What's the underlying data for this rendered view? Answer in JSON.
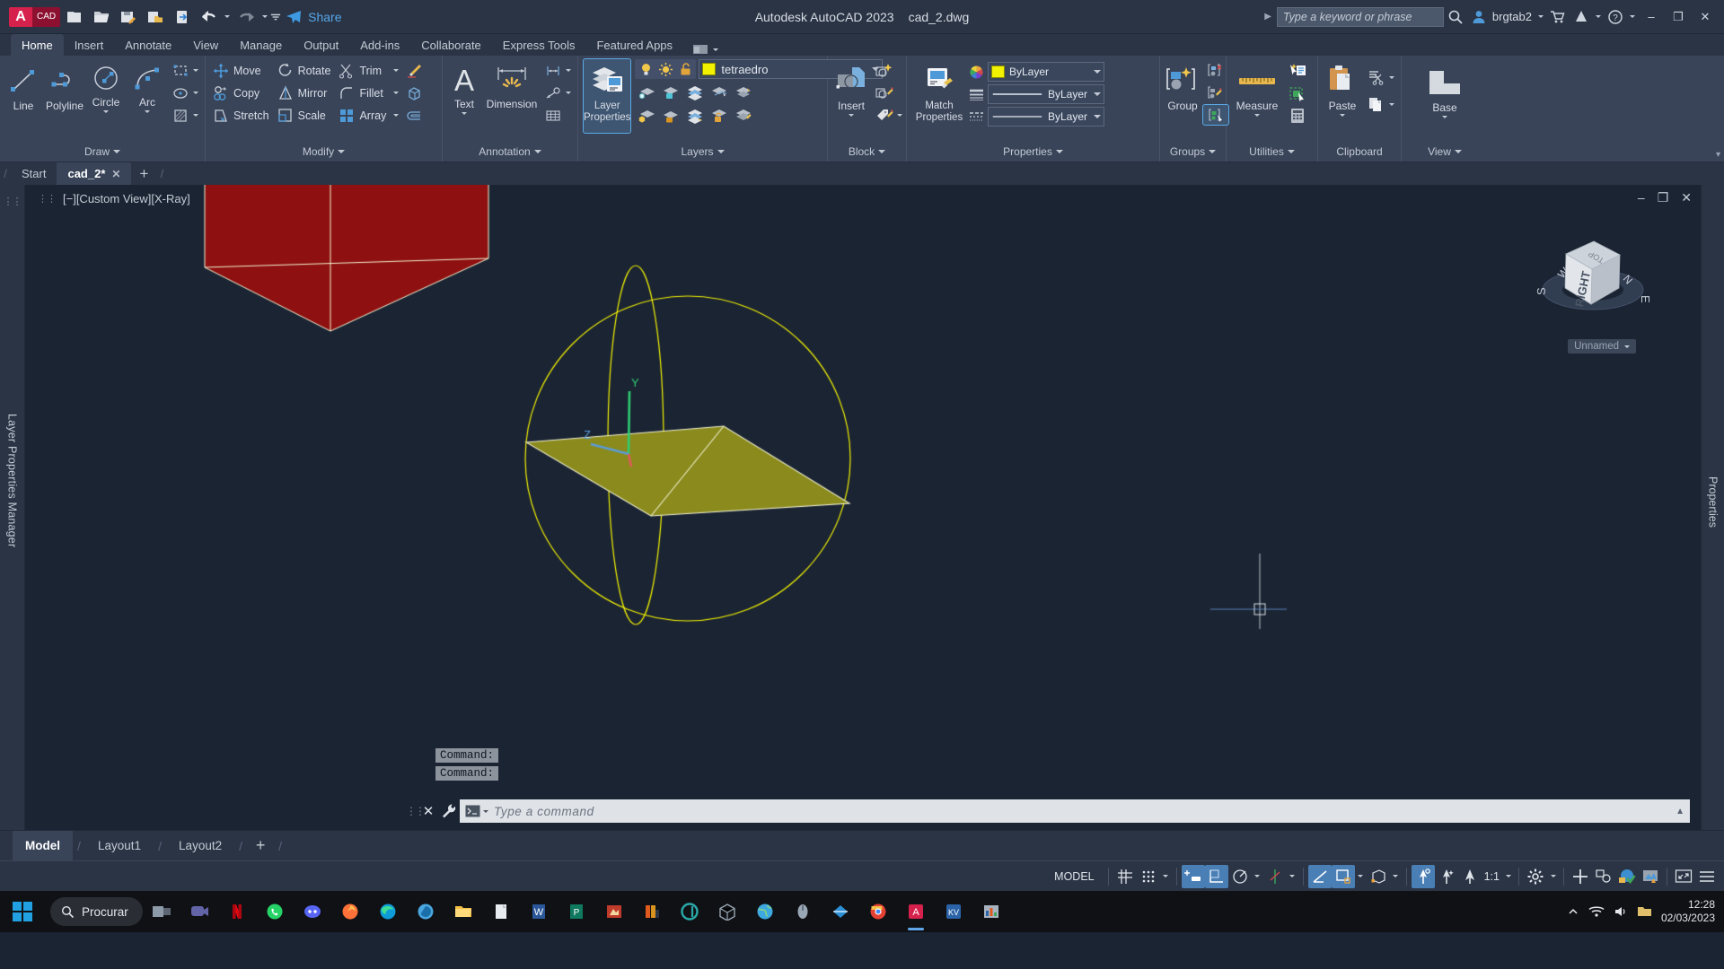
{
  "titlebar": {
    "logo_a": "A",
    "logo_cad": "CAD",
    "share_label": "Share",
    "app_title": "Autodesk AutoCAD 2023",
    "file_name": "cad_2.dwg",
    "search_placeholder": "Type a keyword or phrase",
    "user_name": "brgtab2",
    "quick_access": [
      {
        "name": "new-icon",
        "label": "New"
      },
      {
        "name": "open-icon",
        "label": "Open"
      },
      {
        "name": "save-icon",
        "label": "Save"
      },
      {
        "name": "saveas-icon",
        "label": "Save As"
      },
      {
        "name": "plot-icon",
        "label": "Plot"
      },
      {
        "name": "undo-icon",
        "label": "Undo"
      },
      {
        "name": "redo-icon",
        "label": "Redo"
      }
    ],
    "window_buttons": {
      "minimize": "–",
      "maximize": "❐",
      "close": "✕"
    }
  },
  "ribbon_tabs": [
    {
      "label": "Home",
      "active": true
    },
    {
      "label": "Insert",
      "active": false
    },
    {
      "label": "Annotate",
      "active": false
    },
    {
      "label": "View",
      "active": false
    },
    {
      "label": "Manage",
      "active": false
    },
    {
      "label": "Output",
      "active": false
    },
    {
      "label": "Add-ins",
      "active": false
    },
    {
      "label": "Collaborate",
      "active": false
    },
    {
      "label": "Express Tools",
      "active": false
    },
    {
      "label": "Featured Apps",
      "active": false
    }
  ],
  "ribbon": {
    "draw": {
      "title": "Draw",
      "big": [
        {
          "label": "Line",
          "icon": "line-icon",
          "caret": false
        },
        {
          "label": "Polyline",
          "icon": "polyline-icon",
          "caret": false
        },
        {
          "label": "Circle",
          "icon": "circle-icon",
          "caret": true
        },
        {
          "label": "Arc",
          "icon": "arc-icon",
          "caret": true
        }
      ],
      "small": [
        {
          "label": "",
          "icon": "rectangle-icon",
          "caret": true
        },
        {
          "label": "",
          "icon": "ellipse-icon",
          "caret": true
        },
        {
          "label": "",
          "icon": "hatch-icon",
          "caret": true
        }
      ]
    },
    "modify": {
      "title": "Modify",
      "items": [
        {
          "label": "Move",
          "icon": "move-icon"
        },
        {
          "label": "Rotate",
          "icon": "rotate-icon"
        },
        {
          "label": "Trim",
          "icon": "trim-icon",
          "caret": true
        },
        {
          "label": "Copy",
          "icon": "copy-icon"
        },
        {
          "label": "Mirror",
          "icon": "mirror-icon"
        },
        {
          "label": "Fillet",
          "icon": "fillet-icon",
          "caret": true
        },
        {
          "label": "Stretch",
          "icon": "stretch-icon"
        },
        {
          "label": "Scale",
          "icon": "scale-icon"
        },
        {
          "label": "Array",
          "icon": "array-icon",
          "caret": true
        }
      ],
      "extra": [
        {
          "icon": "erase-icon"
        },
        {
          "icon": "explode-icon"
        },
        {
          "icon": "join-icon"
        }
      ]
    },
    "annotation": {
      "title": "Annotation",
      "big": [
        {
          "label": "Text",
          "icon": "text-icon",
          "caret": true
        },
        {
          "label": "Dimension",
          "icon": "dimension-icon",
          "caret": false
        }
      ],
      "small": [
        {
          "icon": "linear-dim-icon",
          "caret": true
        },
        {
          "icon": "leader-icon",
          "caret": true
        },
        {
          "icon": "table-icon",
          "caret": false
        }
      ]
    },
    "layers": {
      "title": "Layers",
      "big": {
        "label": "Layer\nProperties",
        "icon": "layer-properties-icon",
        "selected": true
      },
      "layer_name": "tetraedro",
      "layer_color": "#f2f200",
      "toggles": [
        {
          "icon": "lightbulb-on-icon"
        },
        {
          "icon": "sun-icon"
        },
        {
          "icon": "unlock-icon"
        }
      ],
      "grid_icons": [
        {
          "icon": "layer-isolate-icon"
        },
        {
          "icon": "layer-freeze-icon"
        },
        {
          "icon": "layer-off-icon"
        },
        {
          "icon": "layer-lock-icon"
        },
        {
          "icon": "layer-merge-icon"
        },
        {
          "icon": "layer-unisolate-icon"
        },
        {
          "icon": "layer-thaw-icon"
        },
        {
          "icon": "layer-on-icon"
        },
        {
          "icon": "layer-unlock-icon"
        },
        {
          "icon": "layer-change-icon"
        }
      ]
    },
    "block": {
      "title": "Block",
      "big": {
        "label": "Insert",
        "icon": "insert-block-icon",
        "caret": true
      },
      "small": [
        {
          "icon": "create-block-icon"
        },
        {
          "icon": "edit-block-icon"
        },
        {
          "icon": "define-attributes-icon",
          "caret": true
        }
      ]
    },
    "properties": {
      "title": "Properties",
      "big": {
        "label": "Match\nProperties",
        "icon": "match-properties-icon"
      },
      "color_value": "ByLayer",
      "color_swatch": "#f2f200",
      "linewidth_value": "ByLayer",
      "linetype_value": "ByLayer",
      "icons": [
        {
          "icon": "color-wheel-icon"
        },
        {
          "icon": "lineweight-icon"
        },
        {
          "icon": "linetype-icon"
        }
      ]
    },
    "groups": {
      "title": "Groups",
      "big": {
        "label": "Group",
        "icon": "group-icon"
      },
      "small": [
        {
          "icon": "ungroup-icon"
        },
        {
          "icon": "group-edit-icon"
        },
        {
          "icon": "group-selection-on-icon",
          "selected": true
        }
      ]
    },
    "utilities": {
      "title": "Utilities",
      "big": {
        "label": "Measure",
        "icon": "measure-icon",
        "caret": true
      },
      "small": [
        {
          "icon": "quick-select-icon"
        },
        {
          "icon": "quick-calc-select-icon"
        },
        {
          "icon": "calculator-icon"
        }
      ]
    },
    "clipboard": {
      "title": "Clipboard",
      "big": {
        "label": "Paste",
        "icon": "paste-icon",
        "caret": true
      },
      "small": [
        {
          "icon": "cut-icon",
          "caret": true
        },
        {
          "icon": "copy-clip-icon",
          "caret": true
        }
      ]
    },
    "view": {
      "title": "View",
      "big": {
        "label": "Base",
        "icon": "base-view-icon",
        "caret": true
      }
    }
  },
  "doc_tabs": [
    {
      "label": "Start",
      "active": false,
      "closable": false
    },
    {
      "label": "cad_2*",
      "active": true,
      "closable": true
    }
  ],
  "viewport": {
    "label": "[−][Custom View][X-Ray]",
    "controls": [
      "–",
      "❐",
      "✕"
    ],
    "viewcube_face": "RIGHT",
    "viewcube_top": "TOP",
    "compass": {
      "n": "N",
      "e": "E",
      "s": "S",
      "w": "W"
    },
    "named_view": "Unnamed",
    "ucs_axes": [
      {
        "label": "Y",
        "color": "#2ecc71"
      },
      {
        "label": "Z",
        "color": "#5b9bd5"
      },
      {
        "label": "X",
        "color": "#e05a5a"
      }
    ],
    "shapes": {
      "solid_red_color": "#8e1010",
      "solid_yellow_color": "#8a8a1d",
      "orbit_circle_color": "#f2f200",
      "edge_color": "#f2f2d0"
    }
  },
  "command_history": [
    "Command:",
    "Command:"
  ],
  "command_line": {
    "placeholder": "Type a command",
    "close_label": "✕",
    "tools_icon": "wrench-icon"
  },
  "layout_tabs": [
    {
      "label": "Model",
      "active": true
    },
    {
      "label": "Layout1",
      "active": false
    },
    {
      "label": "Layout2",
      "active": false
    }
  ],
  "statusbar": {
    "model_label": "MODEL",
    "scale": "1:1",
    "items": [
      {
        "name": "grid-display-toggle",
        "icon": "grid-icon",
        "on": false
      },
      {
        "name": "snap-mode-toggle",
        "icon": "snap-icon",
        "on": false,
        "caret": true
      },
      {
        "name": "infer-constraints-toggle",
        "icon": "infer-icon",
        "on": true
      },
      {
        "name": "ortho-mode-toggle",
        "icon": "ortho-icon",
        "on": true
      },
      {
        "name": "polar-tracking-toggle",
        "icon": "polar-icon",
        "on": false,
        "caret": true
      },
      {
        "name": "object-snap-tracking-toggle",
        "icon": "osnap-track-icon",
        "on": false,
        "caret": true
      },
      {
        "name": "object-snap-toggle",
        "icon": "object-snap-icon",
        "on": true
      },
      {
        "name": "lineweight-toggle",
        "icon": "lineweight-display-icon",
        "on": true,
        "caret": true
      },
      {
        "name": "3d-object-snap-toggle",
        "icon": "3d-osnap-icon",
        "on": false,
        "caret": true
      },
      {
        "name": "dynamic-ucs-toggle",
        "icon": "dynamic-ucs-icon",
        "on": true
      },
      {
        "name": "selection-cycling-toggle",
        "icon": "selection-cycling-icon",
        "on": false
      },
      {
        "name": "annotation-visibility-toggle",
        "icon": "annotation-visibility-icon",
        "on": false
      },
      {
        "name": "workspace-switch",
        "icon": "gear-icon",
        "on": false,
        "caret": true
      },
      {
        "name": "isolate-objects",
        "icon": "plus-icon",
        "on": false
      },
      {
        "name": "hardware-acceleration",
        "icon": "graphics-icon",
        "on": false
      },
      {
        "name": "clean-screen",
        "icon": "clean-screen-icon",
        "on": false
      },
      {
        "name": "customization",
        "icon": "hamburger-icon",
        "on": false
      }
    ]
  },
  "taskbar": {
    "search_placeholder": "Procurar",
    "clock_time": "12:28",
    "clock_date": "02/03/2023",
    "apps": [
      {
        "name": "task-view",
        "color": "#8d9aa8"
      },
      {
        "name": "teams",
        "color": "#6264a7"
      },
      {
        "name": "netflix",
        "color": "#e50914"
      },
      {
        "name": "whatsapp",
        "color": "#25d366"
      },
      {
        "name": "discord",
        "color": "#5865f2"
      },
      {
        "name": "firefox",
        "color": "#ff7139"
      },
      {
        "name": "edge",
        "color": "#0f9bd7"
      },
      {
        "name": "explorer-blue",
        "color": "#4aa7e0"
      },
      {
        "name": "file-explorer",
        "color": "#f5c046"
      },
      {
        "name": "word",
        "color": "#e8ebef"
      },
      {
        "name": "word-2",
        "color": "#2b579a"
      },
      {
        "name": "publisher",
        "color": "#0f7a5f"
      },
      {
        "name": "filezilla",
        "color": "#bf3b2b"
      },
      {
        "name": "media",
        "color": "#e05a1e"
      },
      {
        "name": "qbittorrent",
        "color": "#2aa8a8"
      },
      {
        "name": "3d-viewer",
        "color": "#9aa7b4"
      },
      {
        "name": "earth",
        "color": "#3da9e0"
      },
      {
        "name": "mouse",
        "color": "#9aa7b4"
      },
      {
        "name": "sketch",
        "color": "#2c8fd6"
      },
      {
        "name": "chrome",
        "color": "#e34133"
      },
      {
        "name": "autocad",
        "color": "#d5214b",
        "active": true
      },
      {
        "name": "autocad-kv",
        "color": "#2b63a8"
      },
      {
        "name": "chart-app",
        "color": "#a9b3c0"
      }
    ]
  }
}
